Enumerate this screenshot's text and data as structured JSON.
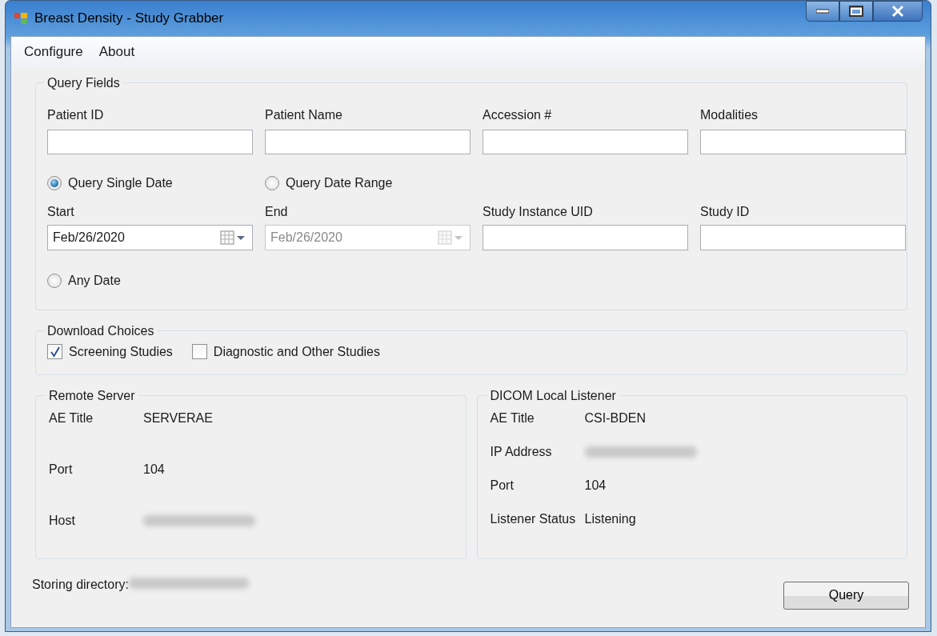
{
  "window": {
    "title": "Breast Density - Study Grabber"
  },
  "menu": [
    "Configure",
    "About"
  ],
  "query_fields": {
    "title": "Query Fields",
    "fields": [
      {
        "label": "Patient ID"
      },
      {
        "label": "Patient Name"
      },
      {
        "label": "Accession #"
      },
      {
        "label": "Modalities"
      }
    ],
    "date_modes": [
      {
        "label": "Query Single Date",
        "selected": true
      },
      {
        "label": "Query Date Range",
        "selected": false
      },
      {
        "label": "Any Date",
        "selected": false
      }
    ],
    "dates": [
      {
        "label": "Start",
        "value": "Feb/26/2020",
        "disabled": false
      },
      {
        "label": "End",
        "value": "Feb/26/2020",
        "disabled": true
      }
    ],
    "uid_fields": [
      {
        "label": "Study Instance UID"
      },
      {
        "label": "Study ID"
      }
    ]
  },
  "download_choices": {
    "title": "Download Choices",
    "options": [
      {
        "label": "Screening Studies",
        "checked": true
      },
      {
        "label": "Diagnostic and Other Studies",
        "checked": false
      }
    ]
  },
  "remote_server": {
    "title": "Remote Server",
    "rows": [
      {
        "label": "AE Title",
        "value": "SERVERAE"
      },
      {
        "label": "Port",
        "value": "104"
      },
      {
        "label": "Host",
        "redacted": true
      }
    ]
  },
  "local_listener": {
    "title": "DICOM Local Listener",
    "rows": [
      {
        "label": "AE Title",
        "value": "CSI-BDEN"
      },
      {
        "label": "IP Address",
        "redacted": true
      },
      {
        "label": "Port",
        "value": "104"
      },
      {
        "label": "Listener Status",
        "value": "Listening"
      }
    ]
  },
  "footer": {
    "storing_label": "Storing directory:",
    "storing_redacted": true,
    "query_button": "Query"
  }
}
